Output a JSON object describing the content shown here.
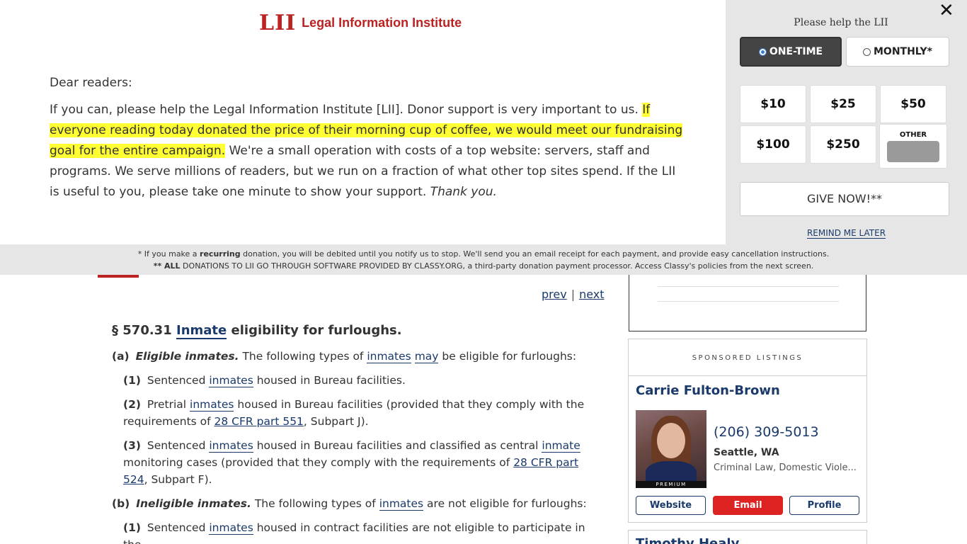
{
  "donation": {
    "logo_mark": "LII",
    "logo_text": "Legal Information Institute",
    "greeting": "Dear readers:",
    "body_start": "If you can, please help the Legal Information Institute [LII]. Donor support is very important to us. ",
    "body_highlight": "If everyone reading today donated the price of their morning cup of coffee, we would meet our fundraising goal for the entire campaign.",
    "body_rest": " We're a small operation with costs of a top website: servers, staff and programs. We serve millions of readers, but we run on a fraction of what other top sites spend. If the LII is useful to you, please take one minute to show your support. ",
    "body_thanks": "Thank you.",
    "close_label": "✕",
    "help_title": "Please help the LII",
    "onetime_label": "ONE-TIME",
    "monthly_label": "MONTHLY*",
    "amounts": [
      "$10",
      "$25",
      "$50",
      "$100",
      "$250"
    ],
    "other_label": "OTHER",
    "give_label": "GIVE NOW!**",
    "remind_label": "REMIND ME LATER",
    "foot_line1_a": "* If you make a ",
    "foot_line1_b": "recurring",
    "foot_line1_c": " donation, you will be debited until you notify us to stop. We'll send you an email receipt for each payment, and provide easy cancellation instructions.",
    "foot_line2_a": "** ALL",
    "foot_line2_b": " DONATIONS TO LII GO THROUGH SOFTWARE PROVIDED BY CLASSY.ORG, a third-party donation payment processor. Access Classy's policies from the next screen.",
    "accent_color": "#bb2222",
    "highlight_color": "#ffff33"
  },
  "nav": {
    "prev": "prev",
    "sep": "|",
    "next": "next"
  },
  "section": {
    "number": "§ 570.31",
    "title_term": "Inmate",
    "title_rest": "eligibility for furloughs.",
    "a_label": "(a)",
    "a_heading": "Eligible inmates.",
    "a_text1": "The following types of",
    "a_term1": "inmates",
    "a_term2": "may",
    "a_text2": "be eligible for furloughs:",
    "a1_label": "(1)",
    "a1_text1": "Sentenced",
    "a1_term": "inmates",
    "a1_text2": "housed in Bureau facilities.",
    "a2_label": "(2)",
    "a2_text1": "Pretrial",
    "a2_term": "inmates",
    "a2_text2": "housed in Bureau facilities (provided that they comply with the requirements of",
    "a2_cite": "28 CFR part 551",
    "a2_text3": ", Subpart J).",
    "a3_label": "(3)",
    "a3_text1": "Sentenced",
    "a3_term1": "inmates",
    "a3_text2": "housed in Bureau facilities and classified as central",
    "a3_term2": "inmate",
    "a3_text3": "monitoring cases (provided that they comply with the requirements of",
    "a3_cite": "28 CFR part 524",
    "a3_text4": ", Subpart F).",
    "b_label": "(b)",
    "b_heading": "Ineligible inmates.",
    "b_text1": "The following types of",
    "b_term": "inmates",
    "b_text2": "are not eligible for furloughs:",
    "b1_label": "(1)",
    "b1_text1": "Sentenced",
    "b1_term": "inmates",
    "b1_text2": "housed in contract facilities are not eligible to participate in the"
  },
  "sidebar": {
    "sponsored_label": "SPONSORED LISTINGS",
    "lawyer_name": "Carrie Fulton-Brown",
    "premium_label": "PREMIUM",
    "phone": "(206) 309-5013",
    "city": "Seattle, WA",
    "practice": "Criminal Law, Domestic Viole...",
    "website_label": "Website",
    "email_label": "Email",
    "profile_label": "Profile",
    "next_lawyer": "Timothy Healy"
  }
}
